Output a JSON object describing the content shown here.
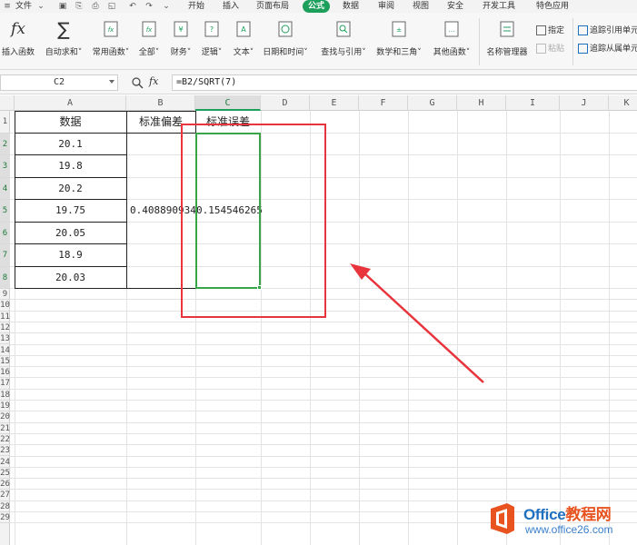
{
  "menubar": {
    "file_label": "文件",
    "tabs": [
      "开始",
      "插入",
      "页面布局",
      "公式",
      "数据",
      "审阅",
      "视图",
      "安全",
      "开发工具",
      "特色应用"
    ],
    "active_tab": "公式"
  },
  "ribbon": {
    "insert_function": "插入函数",
    "autosum": "自动求和",
    "common_functions": "常用函数",
    "all": "全部",
    "finance": "财务",
    "logic": "逻辑",
    "text": "文本",
    "datetime": "日期和时间",
    "lookup": "查找与引用",
    "math": "数学和三角",
    "other_functions": "其他函数",
    "name_manager": "名称管理器",
    "specify": "指定",
    "paste": "粘贴",
    "trace_precedents": "追踪引用单元",
    "trace_dependents": "追踪从属单元"
  },
  "formula_bar": {
    "name_box": "C2",
    "fx": "fx",
    "formula": "=B2/SQRT(7)"
  },
  "columns": [
    "A",
    "B",
    "C",
    "D",
    "E",
    "F",
    "G",
    "H",
    "I",
    "J",
    "K"
  ],
  "selected_column": "C",
  "rows": [
    "1",
    "2",
    "3",
    "4",
    "5",
    "6",
    "7",
    "8",
    "9",
    "10",
    "11",
    "12",
    "13",
    "14",
    "15",
    "16",
    "17",
    "18",
    "19",
    "20",
    "21",
    "22",
    "23",
    "24",
    "25",
    "26",
    "27",
    "28",
    "29"
  ],
  "table": {
    "header_data": "数据",
    "header_std": "标准偏差",
    "header_se": "标准误差",
    "values": [
      "20.1",
      "19.8",
      "20.2",
      "19.75",
      "20.05",
      "18.9",
      "20.03"
    ],
    "std_value": "0.408890934",
    "se_value": "0.154546265"
  },
  "colors": {
    "accent": "#1d9f5c",
    "annotation": "#e8343c"
  },
  "watermark": {
    "brand": "Office",
    "brand_cn": "教程网",
    "url": "www.office26.com"
  }
}
